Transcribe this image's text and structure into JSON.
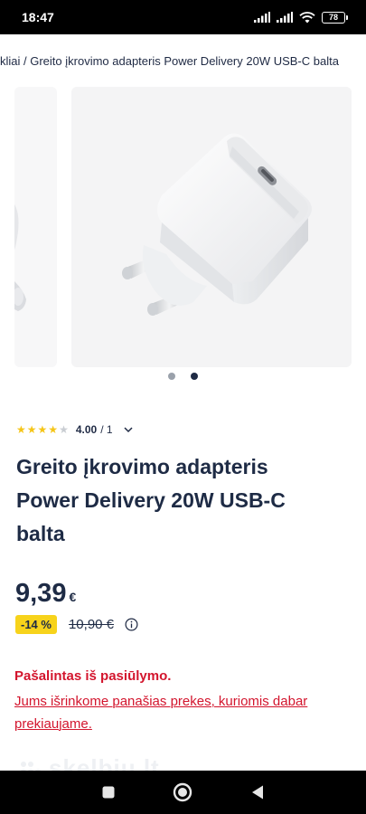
{
  "status_bar": {
    "time": "18:47",
    "battery": "78"
  },
  "breadcrumb": {
    "text": "kliai / Greito įkrovimo adapteris Power Delivery 20W USB-C balta"
  },
  "carousel": {
    "slide_count": 2,
    "active_slide": 2
  },
  "rating": {
    "value": "4.00",
    "count": "/ 1",
    "stars_filled": 4,
    "stars_total": 5
  },
  "product": {
    "title": "Greito įkrovimo adapteris Power Delivery 20W USB-C balta"
  },
  "price": {
    "current": "9,39",
    "currency": "€",
    "discount": "-14 %",
    "old": "10,90 €"
  },
  "notice": {
    "title": "Pašalintas iš pasiūlymo.",
    "description": "Jums išrinkome panašias prekes, kuriomis dabar prekiaujame."
  },
  "watermark": {
    "text": "skelbiu.lt"
  },
  "colors": {
    "text_primary": "#1e2b45",
    "accent_red": "#d3152d",
    "badge_yellow": "#f7d31b",
    "star_fill": "#f5c518",
    "star_empty": "#c9cdd2"
  }
}
